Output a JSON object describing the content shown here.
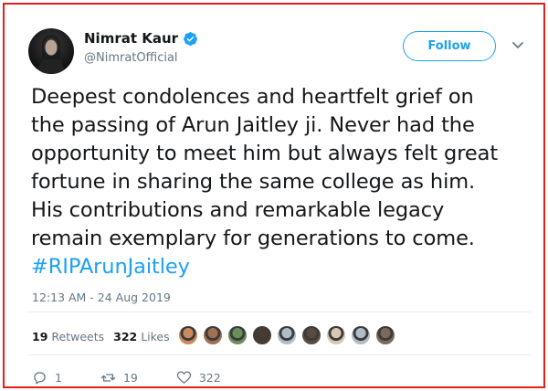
{
  "author": {
    "name": "Nimrat Kaur",
    "handle": "@NimratOfficial",
    "verified_icon": "verified-badge-icon"
  },
  "follow_label": "Follow",
  "tweet": {
    "lines": [
      "Deepest condolences and heartfelt grief on",
      "the passing of Arun Jaitley ji. Never had the",
      "opportunity to meet him but always felt great",
      "fortune in sharing the same college as him.",
      "His contributions and remarkable legacy",
      "remain exemplary for generations to come."
    ],
    "hashtag": "#RIPArunJaitley"
  },
  "timestamp": "12:13 AM - 24 Aug 2019",
  "stats": {
    "retweets_count": "19",
    "retweets_label": "Retweets",
    "likes_count": "322",
    "likes_label": "Likes"
  },
  "likers": [
    "#c98a5e",
    "#a07050",
    "#6b8e5a",
    "#4a3a30",
    "#b0bcc6",
    "#5a4a40",
    "#d8c8b0",
    "#b0bcc6",
    "#7a6a5a"
  ],
  "actions": {
    "reply_count": "1",
    "retweet_count": "19",
    "like_count": "322"
  },
  "colors": {
    "accent": "#1da1f2",
    "border": "#e0201f",
    "muted": "#657786"
  }
}
